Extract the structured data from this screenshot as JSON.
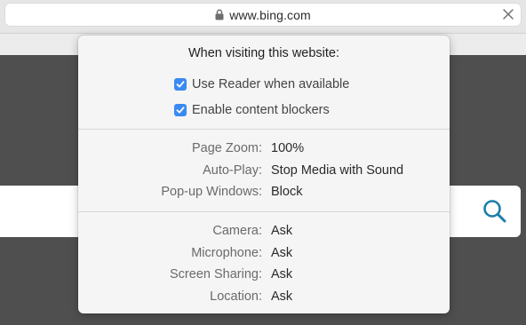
{
  "address_bar": {
    "url": "www.bing.com"
  },
  "popover": {
    "title": "When visiting this website:",
    "checkboxes": [
      {
        "label": "Use Reader when available",
        "checked": true
      },
      {
        "label": "Enable content blockers",
        "checked": true
      }
    ],
    "settings_group_1": [
      {
        "label": "Page Zoom:",
        "value": "100%"
      },
      {
        "label": "Auto-Play:",
        "value": "Stop Media with Sound"
      },
      {
        "label": "Pop-up Windows:",
        "value": "Block"
      }
    ],
    "settings_group_2": [
      {
        "label": "Camera:",
        "value": "Ask"
      },
      {
        "label": "Microphone:",
        "value": "Ask"
      },
      {
        "label": "Screen Sharing:",
        "value": "Ask"
      },
      {
        "label": "Location:",
        "value": "Ask"
      }
    ]
  },
  "colors": {
    "accent": "#3a8af2",
    "search_icon": "#1b7fa8",
    "page_background": "#4f4f4f"
  },
  "icons": {
    "lock": "lock-icon",
    "close": "close-icon",
    "search": "search-icon",
    "checkmark": "checkmark-icon"
  }
}
